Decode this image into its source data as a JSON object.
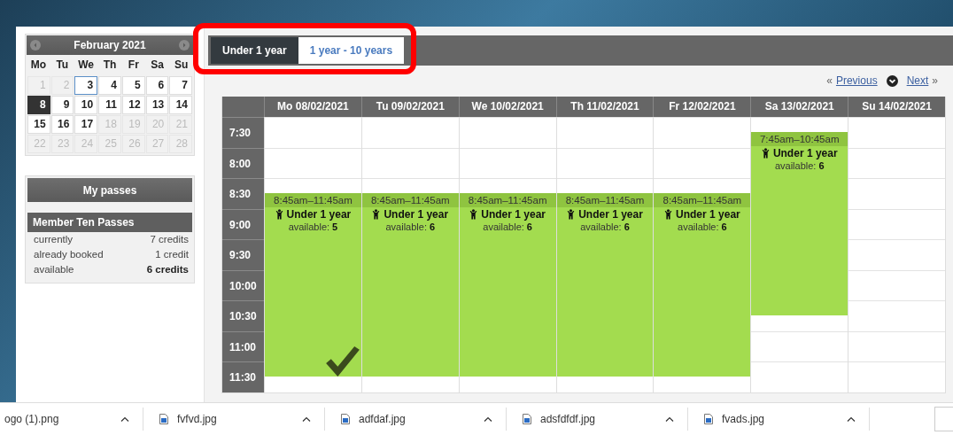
{
  "calendar": {
    "month": "February 2021",
    "weekdays": [
      "Mo",
      "Tu",
      "We",
      "Th",
      "Fr",
      "Sa",
      "Su"
    ],
    "days": [
      {
        "label": "1",
        "disabled": true,
        "selected": false,
        "outlined": false
      },
      {
        "label": "2",
        "disabled": true,
        "selected": false,
        "outlined": false
      },
      {
        "label": "3",
        "disabled": false,
        "selected": false,
        "outlined": true
      },
      {
        "label": "4",
        "disabled": false,
        "selected": false,
        "outlined": false
      },
      {
        "label": "5",
        "disabled": false,
        "selected": false,
        "outlined": false
      },
      {
        "label": "6",
        "disabled": false,
        "selected": false,
        "outlined": false
      },
      {
        "label": "7",
        "disabled": false,
        "selected": false,
        "outlined": false
      },
      {
        "label": "8",
        "disabled": false,
        "selected": true,
        "outlined": false
      },
      {
        "label": "9",
        "disabled": false,
        "selected": false,
        "outlined": false
      },
      {
        "label": "10",
        "disabled": false,
        "selected": false,
        "outlined": false
      },
      {
        "label": "11",
        "disabled": false,
        "selected": false,
        "outlined": false
      },
      {
        "label": "12",
        "disabled": false,
        "selected": false,
        "outlined": false
      },
      {
        "label": "13",
        "disabled": false,
        "selected": false,
        "outlined": false
      },
      {
        "label": "14",
        "disabled": false,
        "selected": false,
        "outlined": false
      },
      {
        "label": "15",
        "disabled": false,
        "selected": false,
        "outlined": false
      },
      {
        "label": "16",
        "disabled": false,
        "selected": false,
        "outlined": false
      },
      {
        "label": "17",
        "disabled": false,
        "selected": false,
        "outlined": false
      },
      {
        "label": "18",
        "disabled": true,
        "selected": false,
        "outlined": false
      },
      {
        "label": "19",
        "disabled": true,
        "selected": false,
        "outlined": false
      },
      {
        "label": "20",
        "disabled": true,
        "selected": false,
        "outlined": false
      },
      {
        "label": "21",
        "disabled": true,
        "selected": false,
        "outlined": false
      },
      {
        "label": "22",
        "disabled": true,
        "selected": false,
        "outlined": false
      },
      {
        "label": "23",
        "disabled": true,
        "selected": false,
        "outlined": false
      },
      {
        "label": "24",
        "disabled": true,
        "selected": false,
        "outlined": false
      },
      {
        "label": "25",
        "disabled": true,
        "selected": false,
        "outlined": false
      },
      {
        "label": "26",
        "disabled": true,
        "selected": false,
        "outlined": false
      },
      {
        "label": "27",
        "disabled": true,
        "selected": false,
        "outlined": false
      },
      {
        "label": "28",
        "disabled": true,
        "selected": false,
        "outlined": false
      }
    ]
  },
  "passes": {
    "button": "My passes",
    "title": "Member Ten Passes",
    "rows": [
      {
        "label": "currently",
        "value": "7 credits",
        "emphasis": false
      },
      {
        "label": "already booked",
        "value": "1 credit",
        "emphasis": false
      },
      {
        "label": "available",
        "value": "6 credits",
        "emphasis": true
      }
    ]
  },
  "tabs": [
    {
      "label": "Under 1 year",
      "selected": true
    },
    {
      "label": "1 year - 10 years",
      "selected": false
    }
  ],
  "highlight_frame": true,
  "pager": {
    "prev_mark": "«",
    "previous": "Previous",
    "next": "Next",
    "next_mark": "»"
  },
  "schedule": {
    "times": [
      "7:30",
      "8:00",
      "8:30",
      "9:00",
      "9:30",
      "10:00",
      "10:30",
      "11:00",
      "11:30"
    ],
    "days": [
      {
        "header": "Mo 08/02/2021",
        "event": {
          "time": "8:45am–11:45am",
          "title": "Under 1 year",
          "available_label": "available:",
          "available": "5",
          "booked": true
        }
      },
      {
        "header": "Tu 09/02/2021",
        "event": {
          "time": "8:45am–11:45am",
          "title": "Under 1 year",
          "available_label": "available:",
          "available": "6",
          "booked": false
        }
      },
      {
        "header": "We 10/02/2021",
        "event": {
          "time": "8:45am–11:45am",
          "title": "Under 1 year",
          "available_label": "available:",
          "available": "6",
          "booked": false
        }
      },
      {
        "header": "Th 11/02/2021",
        "event": {
          "time": "8:45am–11:45am",
          "title": "Under 1 year",
          "available_label": "available:",
          "available": "6",
          "booked": false
        }
      },
      {
        "header": "Fr 12/02/2021",
        "event": {
          "time": "8:45am–11:45am",
          "title": "Under 1 year",
          "available_label": "available:",
          "available": "6",
          "booked": false
        }
      },
      {
        "header": "Sa 13/02/2021",
        "event": {
          "time": "7:45am–10:45am",
          "title": "Under 1 year",
          "available_label": "available:",
          "available": "6",
          "booked": false
        }
      },
      {
        "header": "Su 14/02/2021"
      }
    ]
  },
  "downloads": [
    {
      "name": "ogo (1).png",
      "icon": false
    },
    {
      "name": "fvfvd.jpg",
      "icon": true
    },
    {
      "name": "adfdaf.jpg",
      "icon": true
    },
    {
      "name": "adsfdfdf.jpg",
      "icon": true
    },
    {
      "name": "fvads.jpg",
      "icon": true
    }
  ]
}
